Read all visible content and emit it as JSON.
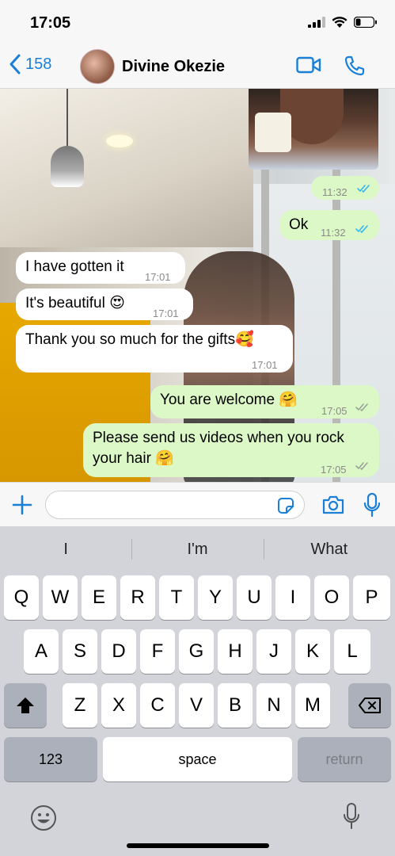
{
  "status_bar": {
    "time": "17:05"
  },
  "header": {
    "back_count": "158",
    "contact_name": "Divine Okezie"
  },
  "messages": [
    {
      "dir": "out",
      "text": "",
      "time": "11:32"
    },
    {
      "dir": "out",
      "text": "Ok",
      "time": "11:32"
    },
    {
      "dir": "in",
      "text": "I have gotten it",
      "time": "17:01"
    },
    {
      "dir": "in",
      "text": "It's beautiful 😍",
      "time": "17:01"
    },
    {
      "dir": "in",
      "text": "Thank you so much for the gifts🥰",
      "time": "17:01"
    },
    {
      "dir": "out",
      "text": "You are welcome 🤗",
      "time": "17:05"
    },
    {
      "dir": "out",
      "text": "Please send us videos when you rock your hair 🤗",
      "time": "17:05"
    }
  ],
  "input": {
    "value": "",
    "placeholder": ""
  },
  "keyboard": {
    "suggestions": [
      "I",
      "I'm",
      "What"
    ],
    "row1": [
      "Q",
      "W",
      "E",
      "R",
      "T",
      "Y",
      "U",
      "I",
      "O",
      "P"
    ],
    "row2": [
      "A",
      "S",
      "D",
      "F",
      "G",
      "H",
      "J",
      "K",
      "L"
    ],
    "row3": [
      "Z",
      "X",
      "C",
      "V",
      "B",
      "N",
      "M"
    ],
    "numbers_label": "123",
    "space_label": "space",
    "return_label": "return"
  },
  "colors": {
    "accent": "#1a7fd6",
    "outgoing_bubble": "#dcf8c6",
    "incoming_bubble": "#ffffff",
    "read_tick": "#34b7f1"
  }
}
